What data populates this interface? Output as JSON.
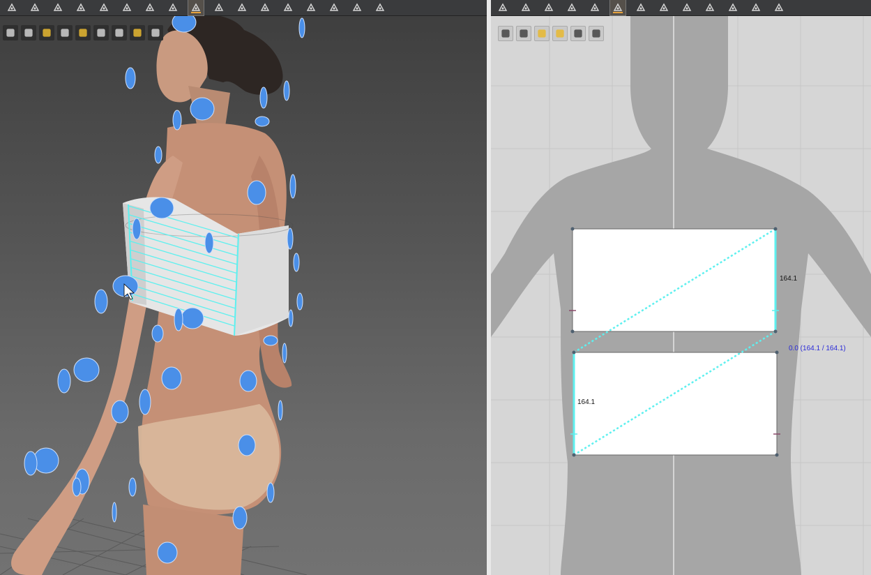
{
  "toolbars": {
    "left_icons": [
      "select-icon",
      "move-icon",
      "transform-icon",
      "garment-icon",
      "wand-icon",
      "avatar-icon",
      "camera-icon",
      "segment-tool-icon",
      "grid-icon",
      "tack-icon",
      "pin-icon",
      "fold-icon",
      "button-icon",
      "zipper-icon",
      "hanger-icon",
      "measure-icon",
      "pose-icon"
    ],
    "right_icons": [
      "edit-point-icon",
      "transform-pattern-icon",
      "circle-icon",
      "polygon-icon",
      "pattern-tool-icon",
      "segment-tool-icon",
      "grid-icon",
      "iron-icon",
      "avatar-icon",
      "pin-icon",
      "stitch-icon",
      "dart-icon",
      "shirt-icon"
    ],
    "active_color": "#e6a23c"
  },
  "viewport_3d": {
    "subtoolbar_icons": [
      "render-icon",
      "garment-icon",
      "flower-icon",
      "avatar-icon",
      "texture-icon",
      "shading-icon",
      "skin-icon",
      "globe-icon",
      "camera-icon"
    ],
    "point_color": "#4a8fe8",
    "seam_color": "#5ef0ef"
  },
  "view_2d": {
    "subtoolbar_icons": [
      "brush-icon",
      "shirt-eye-icon",
      "info-icon",
      "fabric-icon",
      "layer-icon",
      "export-icon"
    ],
    "pattern_top": {
      "right_edge_length": "164.1"
    },
    "pattern_bottom": {
      "left_edge_length": "164.1"
    },
    "segment_readout": "0.0 (164.1 / 164.1)"
  }
}
